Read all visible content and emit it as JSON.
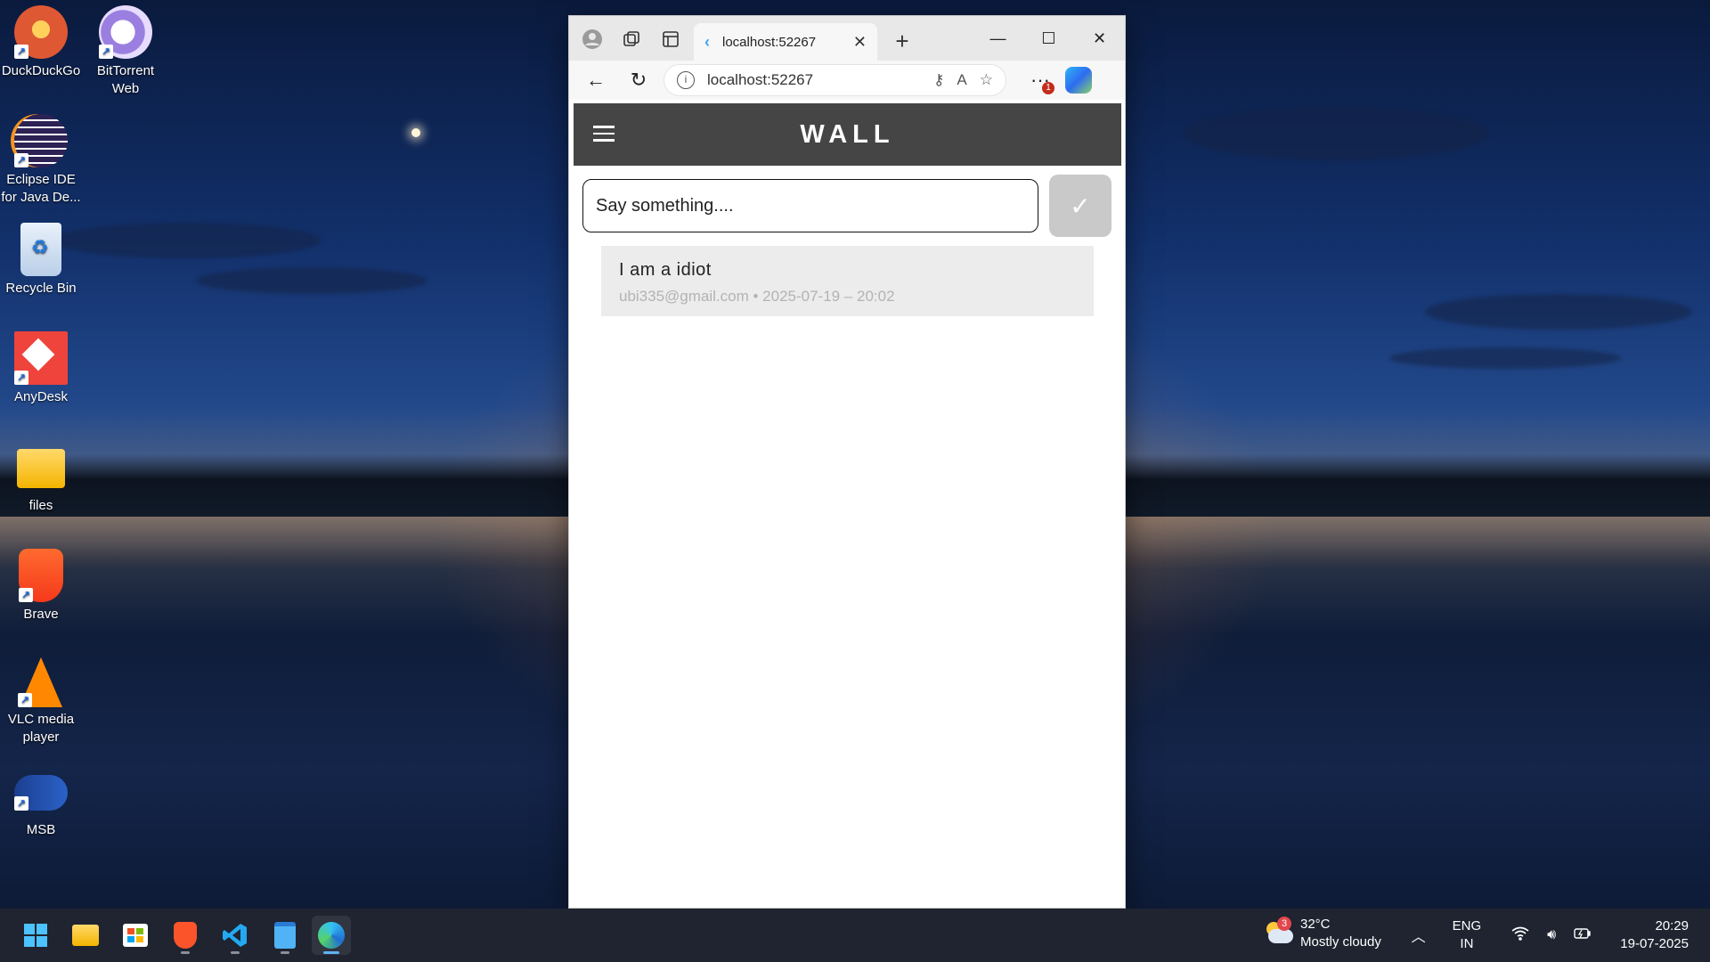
{
  "desktop": {
    "icons": [
      {
        "label": "DuckDuckGo",
        "icon": "duckduckgo-icon"
      },
      {
        "label": "BitTorrent Web",
        "icon": "bittorrent-icon"
      },
      {
        "label": "Eclipse IDE for Java De...",
        "icon": "eclipse-icon"
      },
      {
        "label": "Recycle Bin",
        "icon": "recycle-bin-icon"
      },
      {
        "label": "AnyDesk",
        "icon": "anydesk-icon"
      },
      {
        "label": "files",
        "icon": "folder-icon"
      },
      {
        "label": "Brave",
        "icon": "brave-icon"
      },
      {
        "label": "VLC media player",
        "icon": "vlc-icon"
      },
      {
        "label": "MSB",
        "icon": "msb-icon"
      }
    ]
  },
  "browser": {
    "tab_title": "localhost:52267",
    "address": "localhost:52267",
    "notification_count": "1"
  },
  "app": {
    "title": "WALL",
    "input_placeholder": "Say something....",
    "posts": [
      {
        "message": "I am a idiot",
        "meta": "ubi335@gmail.com • 2025-07-19 – 20:02"
      }
    ]
  },
  "taskbar": {
    "weather_badge": "3",
    "temperature": "32°C",
    "condition": "Mostly cloudy",
    "lang_line1": "ENG",
    "lang_line2": "IN",
    "time": "20:29",
    "date": "19-07-2025"
  }
}
